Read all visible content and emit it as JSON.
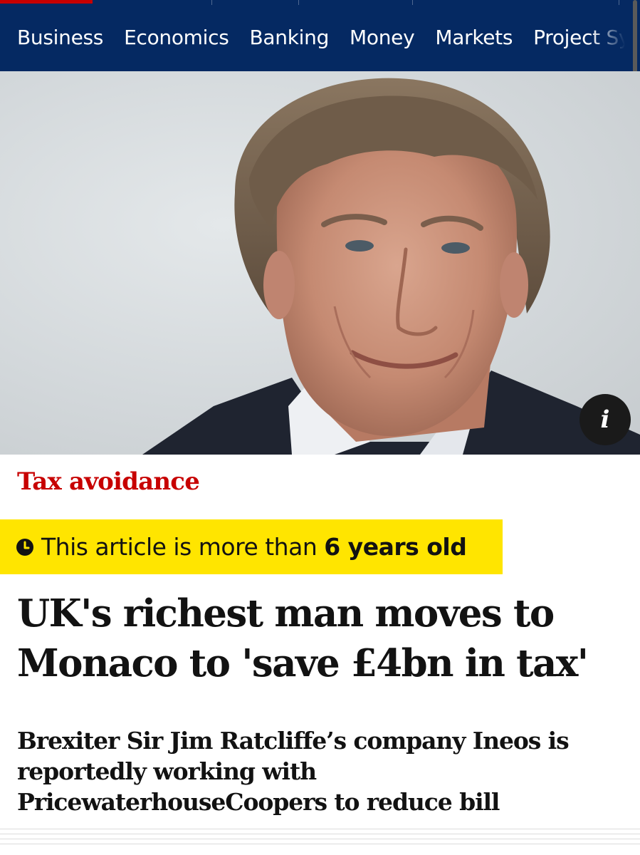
{
  "nav": {
    "items": [
      {
        "label": "Business"
      },
      {
        "label": "Economics"
      },
      {
        "label": "Banking"
      },
      {
        "label": "Money"
      },
      {
        "label": "Markets"
      },
      {
        "label": "Project Syndicate"
      }
    ]
  },
  "hero": {
    "info_icon": "info-icon",
    "info_label": "i"
  },
  "article": {
    "section": "Tax avoidance",
    "age_notice": {
      "prefix": "This article is more than ",
      "emphasis": "6 years old",
      "icon": "clock-icon"
    },
    "headline": "UK's richest man moves to Monaco to 'save £4bn in tax'",
    "standfirst": "Brexiter Sir Jim Ratcliffe’s company Ineos is reportedly working with PricewaterhouseCoopers to reduce bill"
  },
  "colors": {
    "nav_bg": "#052962",
    "section_red": "#c70000",
    "badge_yellow": "#ffe500",
    "text": "#121212"
  }
}
